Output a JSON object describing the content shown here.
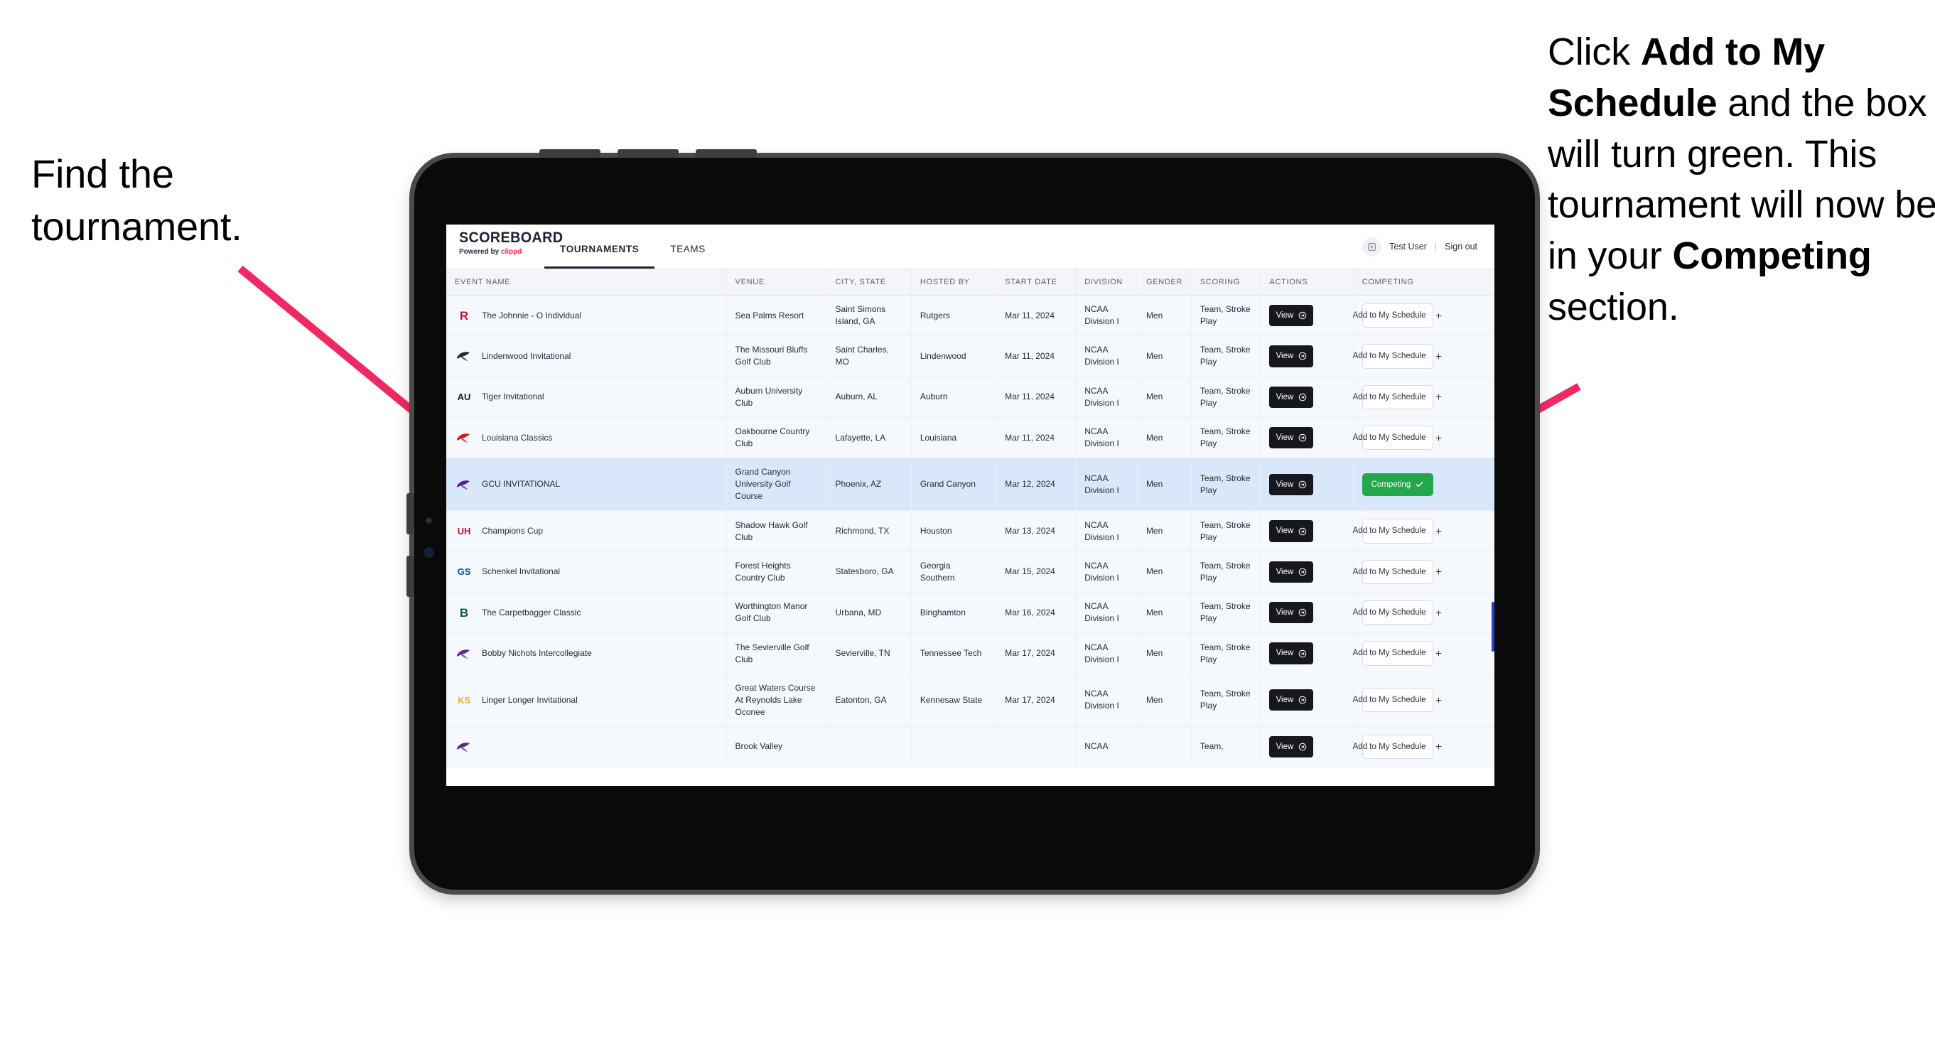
{
  "annotations": {
    "left": "Find the tournament.",
    "right_parts": [
      {
        "text": "Click ",
        "bold": false
      },
      {
        "text": "Add to My Schedule",
        "bold": true
      },
      {
        "text": " and the box will turn green. This tournament will now be in your ",
        "bold": false
      },
      {
        "text": "Competing",
        "bold": true
      },
      {
        "text": " section.",
        "bold": false
      }
    ]
  },
  "app": {
    "brand": {
      "title": "SCOREBOARD",
      "powered_prefix": "Powered by ",
      "powered_name": "clippd"
    },
    "nav": [
      {
        "label": "TOURNAMENTS",
        "active": true
      },
      {
        "label": "TEAMS",
        "active": false
      }
    ],
    "account": {
      "avatar_icon": "user-avatar-icon",
      "user": "Test User",
      "separator": "|",
      "signout": "Sign out"
    },
    "table": {
      "headers": [
        "EVENT NAME",
        "VENUE",
        "CITY, STATE",
        "HOSTED BY",
        "START DATE",
        "DIVISION",
        "GENDER",
        "SCORING",
        "ACTIONS",
        "COMPETING"
      ],
      "view_label": "View",
      "add_label": "Add to My Schedule",
      "competing_label": "Competing",
      "rows": [
        {
          "logo": "rutgers-logo",
          "logo_text": "R",
          "logo_color": "#c8102e",
          "event": "The Johnnie - O Individual",
          "venue": "Sea Palms Resort",
          "city": "Saint Simons Island, GA",
          "host": "Rutgers",
          "date": "Mar 11, 2024",
          "division": "NCAA Division I",
          "gender": "Men",
          "scoring": "Team, Stroke Play",
          "competing": false
        },
        {
          "logo": "lindenwood-logo",
          "logo_text": "",
          "logo_color": "#2a2a22",
          "event": "Lindenwood Invitational",
          "venue": "The Missouri Bluffs Golf Club",
          "city": "Saint Charles, MO",
          "host": "Lindenwood",
          "date": "Mar 11, 2024",
          "division": "NCAA Division I",
          "gender": "Men",
          "scoring": "Team, Stroke Play",
          "competing": false
        },
        {
          "logo": "auburn-logo",
          "logo_text": "AU",
          "logo_color": "#0c2340",
          "event": "Tiger Invitational",
          "venue": "Auburn University Club",
          "city": "Auburn, AL",
          "host": "Auburn",
          "date": "Mar 11, 2024",
          "division": "NCAA Division I",
          "gender": "Men",
          "scoring": "Team, Stroke Play",
          "competing": false
        },
        {
          "logo": "louisiana-ragin-cajuns-logo",
          "logo_text": "",
          "logo_color": "#ce181e",
          "event": "Louisiana Classics",
          "venue": "Oakbourne Country Club",
          "city": "Lafayette, LA",
          "host": "Louisiana",
          "date": "Mar 11, 2024",
          "division": "NCAA Division I",
          "gender": "Men",
          "scoring": "Team, Stroke Play",
          "competing": false
        },
        {
          "logo": "grand-canyon-lopes-logo",
          "logo_text": "",
          "logo_color": "#522398",
          "event": "GCU INVITATIONAL",
          "venue": "Grand Canyon University Golf Course",
          "city": "Phoenix, AZ",
          "host": "Grand Canyon",
          "date": "Mar 12, 2024",
          "division": "NCAA Division I",
          "gender": "Men",
          "scoring": "Team, Stroke Play",
          "competing": true
        },
        {
          "logo": "houston-cougars-logo",
          "logo_text": "UH",
          "logo_color": "#c8102e",
          "event": "Champions Cup",
          "venue": "Shadow Hawk Golf Club",
          "city": "Richmond, TX",
          "host": "Houston",
          "date": "Mar 13, 2024",
          "division": "NCAA Division I",
          "gender": "Men",
          "scoring": "Team, Stroke Play",
          "competing": false
        },
        {
          "logo": "georgia-southern-logo",
          "logo_text": "GS",
          "logo_color": "#01558a",
          "event": "Schenkel Invitational",
          "venue": "Forest Heights Country Club",
          "city": "Statesboro, GA",
          "host": "Georgia Southern",
          "date": "Mar 15, 2024",
          "division": "NCAA Division I",
          "gender": "Men",
          "scoring": "Team, Stroke Play",
          "competing": false
        },
        {
          "logo": "binghamton-bearcats-logo",
          "logo_text": "B",
          "logo_color": "#0d5c3f",
          "event": "The Carpetbagger Classic",
          "venue": "Worthington Manor Golf Club",
          "city": "Urbana, MD",
          "host": "Binghamton",
          "date": "Mar 16, 2024",
          "division": "NCAA Division I",
          "gender": "Men",
          "scoring": "Team, Stroke Play",
          "competing": false
        },
        {
          "logo": "tennessee-tech-logo",
          "logo_text": "",
          "logo_color": "#5c2d8c",
          "event": "Bobby Nichols Intercollegiate",
          "venue": "The Sevierville Golf Club",
          "city": "Sevierville, TN",
          "host": "Tennessee Tech",
          "date": "Mar 17, 2024",
          "division": "NCAA Division I",
          "gender": "Men",
          "scoring": "Team, Stroke Play",
          "competing": false
        },
        {
          "logo": "kennesaw-state-logo",
          "logo_text": "KS",
          "logo_color": "#f0b323",
          "event": "Linger Longer Invitational",
          "venue": "Great Waters Course At Reynolds Lake Oconee",
          "city": "Eatonton, GA",
          "host": "Kennesaw State",
          "date": "Mar 17, 2024",
          "division": "NCAA Division I",
          "gender": "Men",
          "scoring": "Team, Stroke Play",
          "competing": false
        },
        {
          "logo": "east-carolina-logo",
          "logo_text": "",
          "logo_color": "#592a8a",
          "event": "",
          "venue": "Brook Valley",
          "city": "",
          "host": "",
          "date": "",
          "division": "NCAA",
          "gender": "",
          "scoring": "Team,",
          "competing": false
        }
      ]
    }
  }
}
